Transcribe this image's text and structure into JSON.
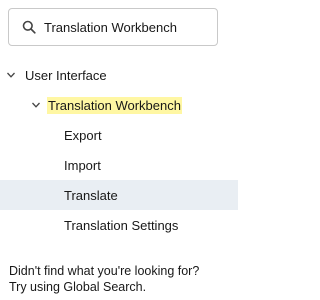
{
  "search": {
    "value": "Translation Workbench",
    "icon": "search-icon"
  },
  "tree": {
    "root": {
      "label": "User Interface",
      "expanded": true
    },
    "group": {
      "label": "Translation Workbench",
      "expanded": true,
      "highlight_color": "#fff7a3"
    },
    "items": [
      {
        "label": "Export",
        "selected": false
      },
      {
        "label": "Import",
        "selected": false
      },
      {
        "label": "Translate",
        "selected": true
      },
      {
        "label": "Translation Settings",
        "selected": false
      }
    ]
  },
  "footer": {
    "line1": "Didn't find what you're looking for?",
    "line2": "Try using Global Search."
  },
  "colors": {
    "selected_bg": "#e9eef3",
    "border": "#c9c9c9"
  }
}
